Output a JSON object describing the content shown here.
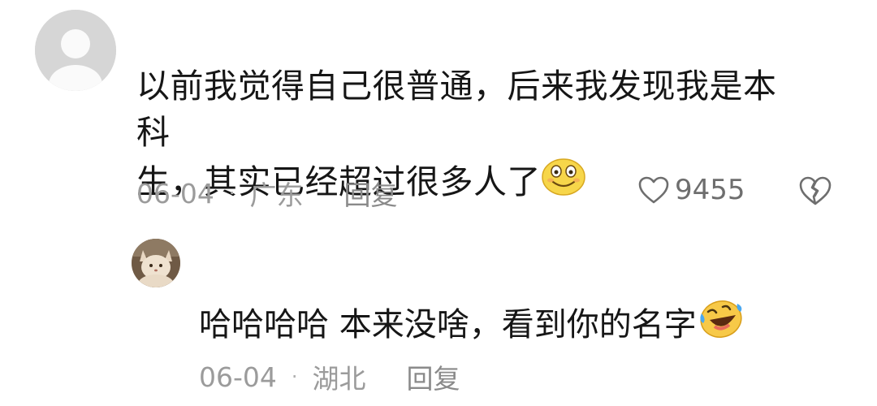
{
  "comment": {
    "avatar_icon": "default-user-icon",
    "text_line1": "以前我觉得自己很普通，后来我发现我是本科",
    "text_line2": "生，其实已经超过很多人了",
    "emoji_icon": "smiling-face-emoji",
    "date": "06-04",
    "dot": "·",
    "location": "广东",
    "reply_label": "回复",
    "like_icon": "heart-outline-icon",
    "like_count": "9455",
    "dislike_icon": "broken-heart-icon"
  },
  "reply": {
    "avatar_icon": "cat-avatar",
    "text": "哈哈哈哈 本来没啥，看到你的名字",
    "emoji_icon": "laughing-tears-emoji",
    "date": "06-04",
    "dot": "·",
    "location": "湖北",
    "reply_label": "回复"
  }
}
